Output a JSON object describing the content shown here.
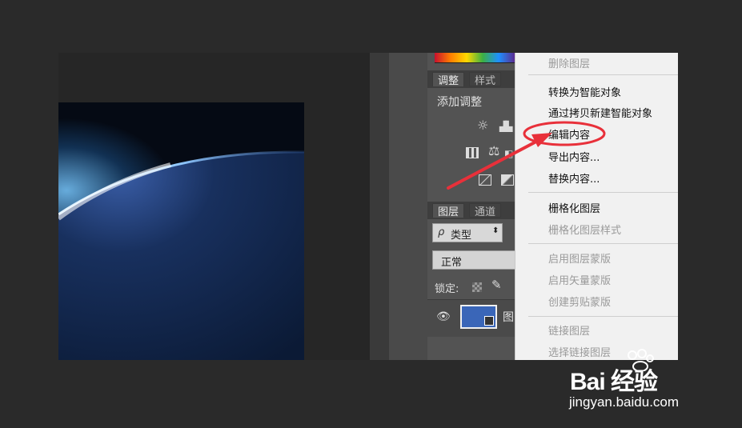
{
  "panels": {
    "adjust_tabs": [
      "调整",
      "样式"
    ],
    "add_adjust_label": "添加调整",
    "layers_tabs": [
      "图层",
      "通道"
    ],
    "filter_kind": {
      "search_icon": "ρ",
      "value": "类型"
    },
    "blend_mode": "正常",
    "lock_label": "锁定:",
    "layer_name_partial": "图"
  },
  "context_menu": {
    "items": [
      {
        "label": "删除图层",
        "enabled": false
      },
      {
        "label": "转换为智能对象",
        "enabled": true
      },
      {
        "label": "通过拷贝新建智能对象",
        "enabled": true
      },
      {
        "label": "编辑内容",
        "enabled": true,
        "highlighted": true
      },
      {
        "label": "导出内容...",
        "enabled": true
      },
      {
        "label": "替换内容...",
        "enabled": true
      },
      {
        "label": "栅格化图层",
        "enabled": true
      },
      {
        "label": "栅格化图层样式",
        "enabled": false
      },
      {
        "label": "启用图层蒙版",
        "enabled": false
      },
      {
        "label": "启用矢量蒙版",
        "enabled": false
      },
      {
        "label": "创建剪贴蒙版",
        "enabled": false
      },
      {
        "label": "链接图层",
        "enabled": false
      },
      {
        "label": "选择链接图层",
        "enabled": false
      }
    ]
  },
  "annotation": {
    "color": "#e8303a"
  },
  "watermark": {
    "logo": "Bai 经验",
    "url": "jingyan.baidu.com"
  }
}
